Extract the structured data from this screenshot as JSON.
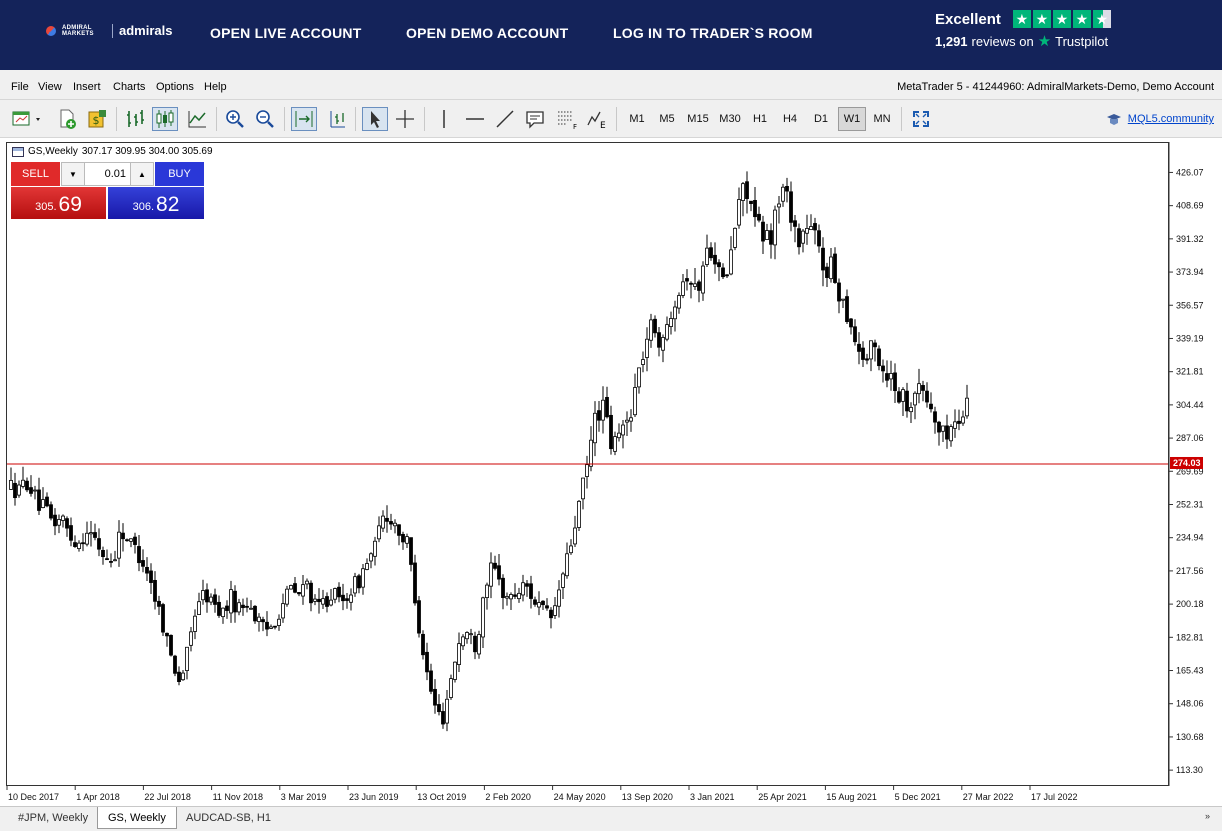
{
  "topbar": {
    "logo_small": "ADMIRAL MARKETS",
    "logo_name": "admirals",
    "links": [
      "OPEN LIVE ACCOUNT",
      "OPEN DEMO ACCOUNT",
      "LOG IN TO TRADER`S ROOM"
    ],
    "trustpilot": {
      "rating_word": "Excellent",
      "reviews_count": "1,291",
      "reviews_on": "reviews on",
      "brand": "Trustpilot"
    }
  },
  "menu": [
    "File",
    "View",
    "Insert",
    "Charts",
    "Options",
    "Help"
  ],
  "account_info": "MetaTrader 5 - 41244960: AdmiralMarkets-Demo, Demo Account",
  "toolbar": {
    "timeframes": [
      "M1",
      "M5",
      "M15",
      "M30",
      "H1",
      "H4",
      "D1",
      "W1",
      "MN"
    ],
    "active_timeframe": "W1",
    "community_link": "MQL5.community"
  },
  "chart": {
    "symbol": "GS,Weekly",
    "ohlc": "307.17 309.95 304.00 305.69",
    "lot": "0.01",
    "sell_label": "SELL",
    "buy_label": "BUY",
    "sell_base": "305.",
    "sell_big": "69",
    "buy_base": "306.",
    "buy_big": "82",
    "hline_label": "274.03",
    "colors": {
      "hline": "#cc0000",
      "sell": "#e02a2a",
      "buy": "#2a38d8"
    }
  },
  "tabs": [
    "#JPM, Weekly",
    "GS, Weekly",
    "AUDCAD-SB, H1"
  ],
  "active_tab": "GS, Weekly",
  "chart_data": {
    "type": "candlestick",
    "y_ticks": [
      "426.07",
      "408.69",
      "391.32",
      "373.94",
      "356.57",
      "339.19",
      "321.81",
      "304.44",
      "287.06",
      "269.69",
      "252.31",
      "234.94",
      "217.56",
      "200.18",
      "182.81",
      "165.43",
      "148.06",
      "130.68",
      "113.30"
    ],
    "x_ticks": [
      "10 Dec 2017",
      "1 Apr 2018",
      "22 Jul 2018",
      "11 Nov 2018",
      "3 Mar 2019",
      "23 Jun 2019",
      "13 Oct 2019",
      "2 Feb 2020",
      "24 May 2020",
      "13 Sep 2020",
      "3 Jan 2021",
      "25 Apr 2021",
      "15 Aug 2021",
      "5 Dec 2021",
      "27 Mar 2022",
      "17 Jul 2022"
    ],
    "ylim": [
      105,
      442
    ],
    "horizontal_line": 274.03,
    "close_path": [
      262,
      260,
      266,
      254,
      250,
      243,
      246,
      236,
      233,
      240,
      233,
      226,
      223,
      240,
      233,
      228,
      220,
      205,
      190,
      172,
      160,
      178,
      203,
      206,
      200,
      196,
      204,
      198,
      203,
      193,
      186,
      191,
      200,
      209,
      205,
      212,
      198,
      202,
      207,
      200,
      208,
      212,
      222,
      230,
      246,
      246,
      238,
      230,
      196,
      168,
      148,
      140,
      162,
      182,
      186,
      178,
      212,
      220,
      208,
      203,
      208,
      210,
      202,
      196,
      193,
      212,
      228,
      250,
      270,
      298,
      305,
      282,
      290,
      298,
      318,
      338,
      348,
      334,
      356,
      368,
      375,
      362,
      382,
      390,
      366,
      380,
      412,
      419,
      400,
      390,
      396,
      419,
      411,
      390,
      398,
      393,
      378,
      376,
      363,
      352,
      336,
      328,
      336,
      324,
      320,
      311,
      306,
      314,
      311,
      299,
      288,
      293,
      296,
      306
    ]
  }
}
